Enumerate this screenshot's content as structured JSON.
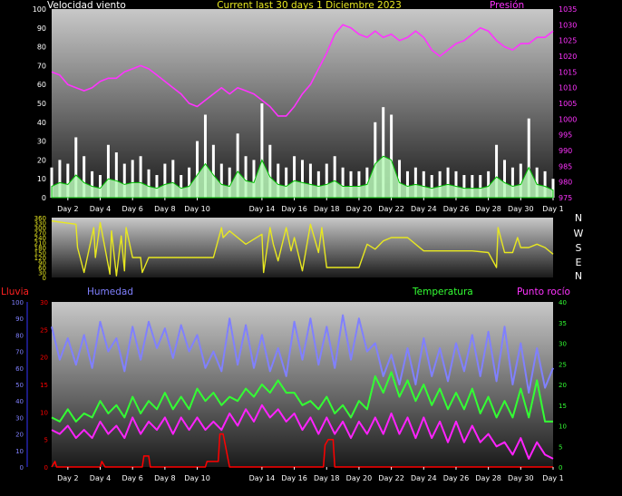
{
  "colors": {
    "wind": "#ffffff",
    "gust_fill": "#ffffff",
    "avg_wind": "#b8f8b8",
    "avg_wind_line": "#00c000",
    "pressure": "#ff33ff",
    "direction": "#e8e820",
    "humidity": "#8080ff",
    "temperature": "#33ff33",
    "dewpoint": "#ff22ff",
    "rain": "#ff0000",
    "rain_axis": "#3333ff",
    "ticks": "#ffffff"
  },
  "chart_data": [
    {
      "type": "line",
      "title": "Current last 30 days 1 Diciembre 2023",
      "left_label": "Velocidad viento",
      "right_label": "Presión",
      "x_tick_labels": [
        "Day 2",
        "Day 4",
        "Day 6",
        "Day 8",
        "Day 10",
        "Day 14",
        "Day 16",
        "Day 18",
        "Day 20",
        "Day 22",
        "Day 24",
        "Day 26",
        "Day 28",
        "Day 30",
        "Day 1"
      ],
      "x_tick_days": [
        2,
        4,
        6,
        8,
        10,
        14,
        16,
        18,
        20,
        22,
        24,
        26,
        28,
        30,
        32
      ],
      "xlim": [
        1,
        32
      ],
      "left_axis": {
        "ylim": [
          0,
          100
        ],
        "ticks": [
          0,
          10,
          20,
          30,
          40,
          50,
          60,
          70,
          80,
          90,
          100
        ]
      },
      "right_axis": {
        "ylim": [
          975,
          1035
        ],
        "ticks": [
          975,
          980,
          985,
          990,
          995,
          1000,
          1005,
          1010,
          1015,
          1020,
          1025,
          1030,
          1035
        ]
      },
      "series": [
        {
          "axis": "right",
          "x": [
            1,
            1.5,
            2,
            2.5,
            3,
            3.5,
            4,
            4.5,
            5,
            5.5,
            6,
            6.5,
            7,
            7.5,
            8,
            8.5,
            9,
            9.5,
            10,
            10.5,
            11,
            11.5,
            12,
            12.5,
            13,
            13.5,
            14,
            14.5,
            15,
            15.5,
            16,
            16.5,
            17,
            17.5,
            18,
            18.5,
            19,
            19.5,
            20,
            20.5,
            21,
            21.5,
            22,
            22.5,
            23,
            23.5,
            24,
            24.5,
            25,
            25.5,
            26,
            26.5,
            27,
            27.5,
            28,
            28.5,
            29,
            29.5,
            30,
            30.5,
            31,
            31.5,
            32
          ],
          "y": [
            1015,
            1014,
            1011,
            1010,
            1009,
            1010,
            1012,
            1013,
            1013,
            1015,
            1016,
            1017,
            1016,
            1014,
            1012,
            1010,
            1008,
            1005,
            1004,
            1006,
            1008,
            1010,
            1008,
            1010,
            1009,
            1008,
            1006,
            1004,
            1001,
            1001,
            1004,
            1008,
            1011,
            1016,
            1021,
            1027,
            1030,
            1029,
            1027,
            1026,
            1028,
            1026,
            1027,
            1025,
            1026,
            1028,
            1026,
            1022,
            1020,
            1022,
            1024,
            1025,
            1027,
            1029,
            1028,
            1025,
            1023,
            1022,
            1024,
            1024,
            1026,
            1026,
            1028
          ]
        },
        {
          "axis": "left",
          "x": [
            1,
            1.5,
            2,
            2.5,
            3,
            3.5,
            4,
            4.5,
            5,
            5.5,
            6,
            6.5,
            7,
            7.5,
            8,
            8.5,
            9,
            9.5,
            10,
            10.5,
            11,
            11.5,
            12,
            12.5,
            13,
            13.5,
            14,
            14.5,
            15,
            15.5,
            16,
            16.5,
            17,
            17.5,
            18,
            18.5,
            19,
            19.5,
            20,
            20.5,
            21,
            21.5,
            22,
            22.5,
            23,
            23.5,
            24,
            24.5,
            25,
            25.5,
            26,
            26.5,
            27,
            27.5,
            28,
            28.5,
            29,
            29.5,
            30,
            30.5,
            31,
            31.5,
            32
          ],
          "y": [
            16,
            20,
            18,
            32,
            22,
            14,
            12,
            28,
            24,
            18,
            20,
            22,
            15,
            12,
            18,
            20,
            12,
            16,
            30,
            44,
            28,
            18,
            16,
            34,
            22,
            20,
            50,
            28,
            18,
            16,
            22,
            20,
            18,
            14,
            18,
            22,
            16,
            14,
            14,
            16,
            40,
            48,
            44,
            20,
            14,
            16,
            14,
            12,
            14,
            16,
            14,
            12,
            12,
            12,
            14,
            28,
            20,
            16,
            18,
            42,
            16,
            14,
            10
          ]
        },
        {
          "axis": "left",
          "x": [
            1,
            1.5,
            2,
            2.5,
            3,
            3.5,
            4,
            4.5,
            5,
            5.5,
            6,
            6.5,
            7,
            7.5,
            8,
            8.5,
            9,
            9.5,
            10,
            10.5,
            11,
            11.5,
            12,
            12.5,
            13,
            13.5,
            14,
            14.5,
            15,
            15.5,
            16,
            16.5,
            17,
            17.5,
            18,
            18.5,
            19,
            19.5,
            20,
            20.5,
            21,
            21.5,
            22,
            22.5,
            23,
            23.5,
            24,
            24.5,
            25,
            25.5,
            26,
            26.5,
            27,
            27.5,
            28,
            28.5,
            29,
            29.5,
            30,
            30.5,
            31,
            31.5,
            32
          ],
          "y": [
            6,
            8,
            7,
            12,
            8,
            6,
            5,
            10,
            9,
            7,
            8,
            8,
            6,
            5,
            7,
            8,
            5,
            6,
            12,
            18,
            12,
            7,
            6,
            14,
            9,
            8,
            20,
            11,
            7,
            6,
            9,
            8,
            7,
            6,
            7,
            9,
            6,
            6,
            6,
            7,
            18,
            22,
            20,
            8,
            6,
            7,
            6,
            5,
            6,
            7,
            6,
            5,
            5,
            5,
            6,
            11,
            8,
            6,
            7,
            16,
            7,
            6,
            4
          ]
        }
      ]
    },
    {
      "type": "line",
      "title": "",
      "right_label": "N W S E N",
      "xlim": [
        1,
        32
      ],
      "y_axis": {
        "ylim": [
          0,
          360
        ],
        "ticks": [
          0,
          30,
          60,
          90,
          120,
          150,
          180,
          210,
          240,
          270,
          300,
          330,
          360
        ]
      },
      "compass": [
        "N",
        "W",
        "S",
        "E",
        "N"
      ],
      "series": [
        {
          "x": [
            1,
            2.5,
            2.6,
            3,
            3.6,
            3.7,
            4,
            4.6,
            4.7,
            5,
            5.3,
            5.5,
            5.6,
            6,
            6.5,
            6.6,
            7,
            8,
            9,
            10,
            11,
            11.5,
            11.6,
            12,
            13,
            14,
            14.1,
            14.5,
            14.7,
            15,
            15.5,
            15.8,
            16,
            16.5,
            17,
            17.5,
            17.7,
            18,
            18.5,
            19,
            20,
            20.5,
            21,
            21.5,
            22,
            23,
            24,
            25,
            26,
            27,
            28,
            28.5,
            28.6,
            29,
            29.5,
            29.8,
            30,
            30.5,
            31,
            31.5,
            32
          ],
          "y": [
            340,
            320,
            180,
            30,
            300,
            120,
            330,
            20,
            280,
            10,
            250,
            40,
            300,
            120,
            120,
            30,
            120,
            120,
            120,
            120,
            120,
            300,
            240,
            280,
            200,
            260,
            30,
            300,
            200,
            100,
            300,
            160,
            240,
            40,
            320,
            150,
            300,
            60,
            60,
            60,
            60,
            200,
            170,
            220,
            240,
            240,
            160,
            160,
            160,
            160,
            150,
            60,
            300,
            150,
            150,
            240,
            180,
            180,
            200,
            180,
            140
          ]
        }
      ]
    },
    {
      "type": "line",
      "title": "",
      "labels": {
        "rain": "Lluvia",
        "humidity": "Humedad",
        "temperature": "Temperatura",
        "dewpoint": "Punto rocío"
      },
      "xlim": [
        1,
        32
      ],
      "left_axis": {
        "name": "Humedad",
        "ylim": [
          0,
          100
        ],
        "ticks": [
          0,
          10,
          20,
          30,
          40,
          50,
          60,
          70,
          80,
          90,
          100
        ]
      },
      "rain_axis": {
        "name": "Lluvia",
        "ylim": [
          0,
          30
        ],
        "ticks": [
          0,
          5,
          10,
          15,
          20,
          25,
          30
        ]
      },
      "right_axis": {
        "name": "Temperatura",
        "ylim": [
          0,
          40
        ],
        "ticks": [
          0,
          5,
          10,
          15,
          20,
          25,
          30,
          35,
          40
        ]
      },
      "series": [
        {
          "name": "Humedad",
          "axis": "left",
          "x": [
            1,
            1.5,
            2,
            2.5,
            3,
            3.5,
            4,
            4.5,
            5,
            5.5,
            6,
            6.5,
            7,
            7.5,
            8,
            8.5,
            9,
            9.5,
            10,
            10.5,
            11,
            11.5,
            12,
            12.5,
            13,
            13.5,
            14,
            14.5,
            15,
            15.5,
            16,
            16.5,
            17,
            17.5,
            18,
            18.5,
            19,
            19.5,
            20,
            20.5,
            21,
            21.5,
            22,
            22.5,
            23,
            23.5,
            24,
            24.5,
            25,
            25.5,
            26,
            26.5,
            27,
            27.5,
            28,
            28.5,
            29,
            29.5,
            30,
            30.5,
            31,
            31.5,
            32
          ],
          "y": [
            85,
            65,
            78,
            62,
            80,
            60,
            88,
            70,
            78,
            58,
            85,
            65,
            88,
            72,
            84,
            66,
            86,
            70,
            80,
            60,
            70,
            58,
            90,
            62,
            86,
            60,
            80,
            58,
            72,
            55,
            88,
            65,
            90,
            62,
            85,
            60,
            92,
            65,
            90,
            70,
            75,
            55,
            68,
            50,
            72,
            50,
            78,
            55,
            72,
            52,
            75,
            58,
            80,
            55,
            82,
            52,
            85,
            50,
            75,
            45,
            72,
            48,
            60
          ]
        },
        {
          "name": "Temperatura",
          "axis": "right",
          "x": [
            1,
            1.5,
            2,
            2.5,
            3,
            3.5,
            4,
            4.5,
            5,
            5.5,
            6,
            6.5,
            7,
            7.5,
            8,
            8.5,
            9,
            9.5,
            10,
            10.5,
            11,
            11.5,
            12,
            12.5,
            13,
            13.5,
            14,
            14.5,
            15,
            15.5,
            16,
            16.5,
            17,
            17.5,
            18,
            18.5,
            19,
            19.5,
            20,
            20.5,
            21,
            21.5,
            22,
            22.5,
            23,
            23.5,
            24,
            24.5,
            25,
            25.5,
            26,
            26.5,
            27,
            27.5,
            28,
            28.5,
            29,
            29.5,
            30,
            30.5,
            31,
            31.5,
            32
          ],
          "y": [
            12,
            11,
            14,
            11,
            13,
            12,
            16,
            13,
            15,
            12,
            17,
            13,
            16,
            14,
            18,
            14,
            17,
            14,
            19,
            16,
            18,
            15,
            17,
            16,
            19,
            17,
            20,
            18,
            21,
            18,
            18,
            15,
            16,
            14,
            17,
            13,
            15,
            12,
            16,
            14,
            22,
            18,
            23,
            17,
            21,
            16,
            20,
            15,
            19,
            14,
            18,
            14,
            19,
            13,
            17,
            12,
            16,
            12,
            19,
            12,
            21,
            11,
            11
          ]
        },
        {
          "name": "Punto rocío",
          "axis": "right",
          "x": [
            1,
            1.5,
            2,
            2.5,
            3,
            3.5,
            4,
            4.5,
            5,
            5.5,
            6,
            6.5,
            7,
            7.5,
            8,
            8.5,
            9,
            9.5,
            10,
            10.5,
            11,
            11.5,
            12,
            12.5,
            13,
            13.5,
            14,
            14.5,
            15,
            15.5,
            16,
            16.5,
            17,
            17.5,
            18,
            18.5,
            19,
            19.5,
            20,
            20.5,
            21,
            21.5,
            22,
            22.5,
            23,
            23.5,
            24,
            24.5,
            25,
            25.5,
            26,
            26.5,
            27,
            27.5,
            28,
            28.5,
            29,
            29.5,
            30,
            30.5,
            31,
            31.5,
            32
          ],
          "y": [
            9,
            8,
            10,
            7,
            9,
            7,
            11,
            8,
            10,
            7,
            12,
            8,
            11,
            9,
            12,
            8,
            12,
            9,
            12,
            9,
            11,
            9,
            13,
            10,
            14,
            11,
            15,
            12,
            14,
            11,
            13,
            9,
            12,
            8,
            12,
            8,
            11,
            7,
            11,
            8,
            12,
            8,
            13,
            8,
            12,
            7,
            12,
            7,
            11,
            6,
            11,
            6,
            10,
            6,
            8,
            5,
            6,
            3,
            7,
            2,
            6,
            3,
            2
          ]
        },
        {
          "name": "Lluvia",
          "axis": "rain",
          "x": [
            1,
            1.2,
            1.3,
            4,
            4.1,
            4.3,
            6.6,
            6.7,
            7,
            7.1,
            10.5,
            10.6,
            11.3,
            11.4,
            11.6,
            12,
            17.8,
            17.9,
            18.1,
            18.4,
            18.5,
            32
          ],
          "y": [
            0,
            1,
            0,
            0,
            1,
            0,
            0,
            2,
            2,
            0,
            0,
            1,
            1,
            6,
            6,
            0,
            0,
            4,
            5,
            5,
            0,
            0
          ]
        }
      ]
    }
  ]
}
